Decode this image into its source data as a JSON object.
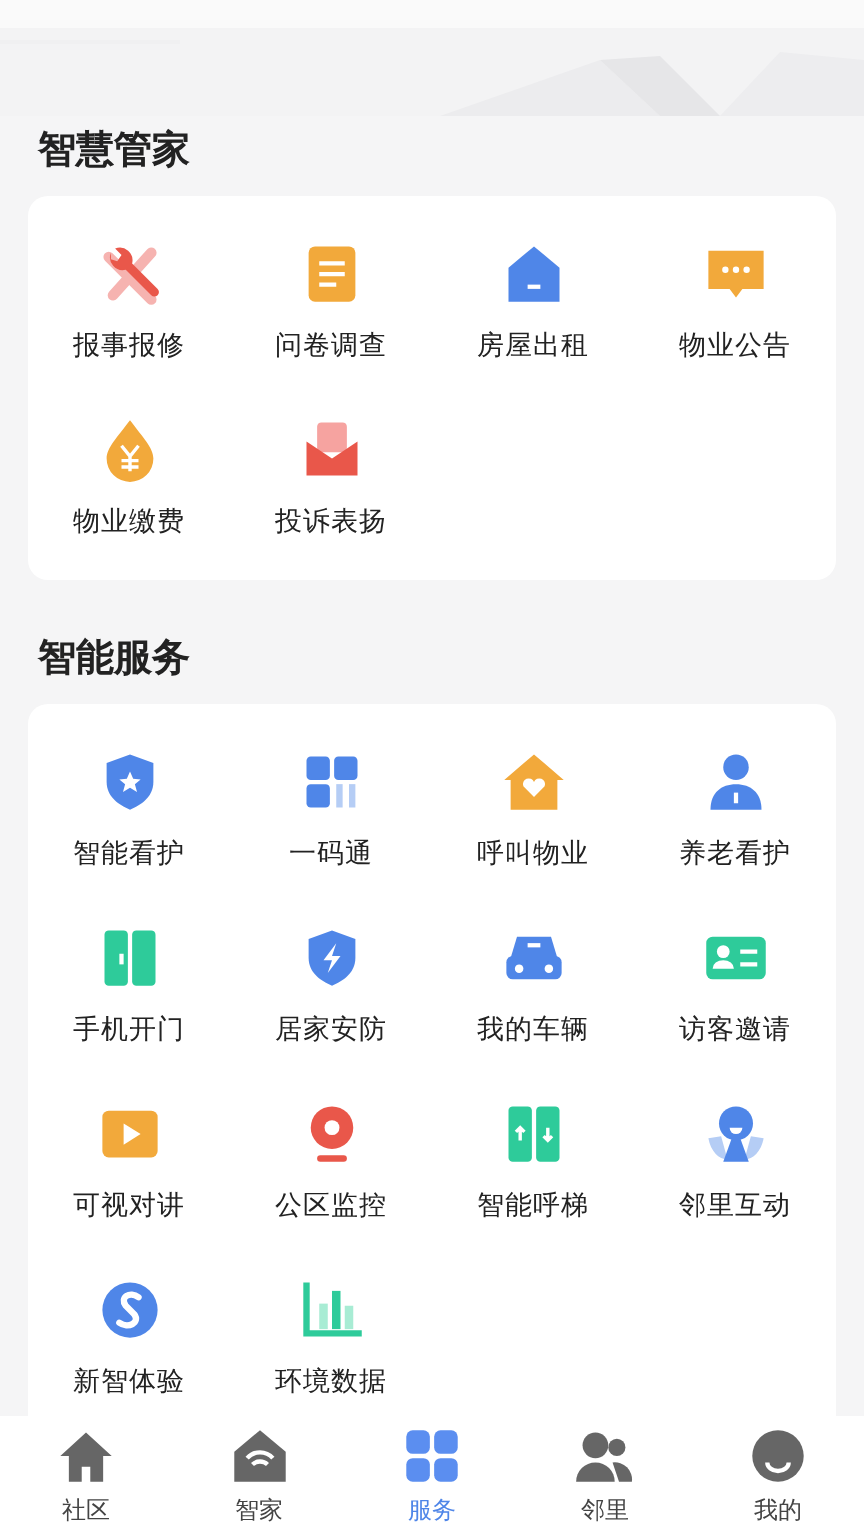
{
  "sections": [
    {
      "title": "智慧管家",
      "items": [
        {
          "label": "报事报修"
        },
        {
          "label": "问卷调查"
        },
        {
          "label": "房屋出租"
        },
        {
          "label": "物业公告"
        },
        {
          "label": "物业缴费"
        },
        {
          "label": "投诉表扬"
        }
      ]
    },
    {
      "title": "智能服务",
      "items": [
        {
          "label": "智能看护"
        },
        {
          "label": "一码通"
        },
        {
          "label": "呼叫物业"
        },
        {
          "label": "养老看护"
        },
        {
          "label": "手机开门"
        },
        {
          "label": "居家安防"
        },
        {
          "label": "我的车辆"
        },
        {
          "label": "访客邀请"
        },
        {
          "label": "可视对讲"
        },
        {
          "label": "公区监控"
        },
        {
          "label": "智能呼梯"
        },
        {
          "label": "邻里互动"
        },
        {
          "label": "新智体验"
        },
        {
          "label": "环境数据"
        }
      ]
    }
  ],
  "tabs": [
    {
      "label": "社区",
      "selected": false
    },
    {
      "label": "智家",
      "selected": false
    },
    {
      "label": "服务",
      "selected": true
    },
    {
      "label": "邻里",
      "selected": false
    },
    {
      "label": "我的",
      "selected": false
    }
  ]
}
